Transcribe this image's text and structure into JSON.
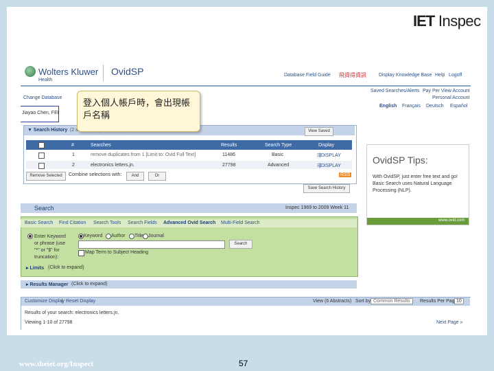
{
  "slide": {
    "logo": {
      "bold": "IET",
      "rest": " Inspec"
    },
    "footer_url": "www.theiet.org/Inspect",
    "page_number": "57"
  },
  "callout": {
    "text": "登入個人帳戶時，會出現帳戶名稱"
  },
  "header": {
    "brand": "Wolters Kluwer",
    "brand_sub": "Health",
    "product": "OvidSP",
    "nav": [
      "Database Field Guide",
      "飛資得資訊",
      "Display Knowledge Base",
      "Help",
      "Logoff"
    ],
    "links_row1": [
      "Saved Searches/Alerts",
      "Pay Per View Account"
    ],
    "links_row2": [
      "Personal Account"
    ],
    "languages": [
      "English",
      "Français",
      "Deutsch",
      "Español"
    ]
  },
  "left": {
    "change_database": "Change Database",
    "user_name": "Jiayao Chen, FEI"
  },
  "history": {
    "title": "Search History",
    "count_note": "(2 searches) (Click to close)",
    "view_saved": "View Saved",
    "columns": [
      "#",
      "Searches",
      "Results",
      "Search Type",
      "Display"
    ],
    "rows": [
      {
        "num": "1",
        "search": "remove duplicates from 1 [Limit to: Ovid Full Text]",
        "results": "11486",
        "type": "Basic",
        "display": "DISPLAY"
      },
      {
        "num": "2",
        "search": "electronics letters.jn.",
        "results": "27798",
        "type": "Advanced",
        "display": "DISPLAY"
      }
    ],
    "remove_selected": "Remove Selected",
    "combine_label": "Combine selections with:",
    "and_btn": "And",
    "or_btn": "Or",
    "rss": "RSS",
    "save_history": "Save Search History"
  },
  "search": {
    "title": "Search",
    "db_info": "Inspec 1969 to 2009 Week 11",
    "tabs": [
      "Basic Search",
      "Find Citation",
      "Search Tools",
      "Search Fields",
      "Advanced Ovid Search",
      "Multi-Field Search"
    ],
    "enter_keyword": "Enter Keyword or phrase (use \"*\" or \"$\" for truncation):",
    "options": [
      "Keyword",
      "Author",
      "Title",
      "Journal"
    ],
    "search_btn": "Search",
    "map_term": "Map Term to Subject Heading",
    "limits": "Limits",
    "limits_note": "(Click to expand)"
  },
  "results_manager": {
    "title": "Results Manager",
    "note": "(Click to expand)"
  },
  "display": {
    "customize": "Customize Display",
    "reset": "Reset Display",
    "view_label": "View (6 Abstracts)",
    "sort_label": "Sort by:",
    "sort_value": "Common Results",
    "per_page_label": "Results Per Page:",
    "per_page_value": "10",
    "results_text": "Results of your search: electronics letters.jn.",
    "viewing": "Viewing 1-10 of 27798",
    "next_page": "Next Page"
  },
  "tips": {
    "title": "OvidSP Tips:",
    "body": "With OvidSP, just enter free text and go! Basic Search uses Natural Language Processing (NLP).",
    "footer": "www.ovid.com"
  },
  "colors": {
    "accent_blue": "#3e6aa6",
    "panel_green": "#c4dfa2",
    "slide_bg": "#c9dde8"
  }
}
